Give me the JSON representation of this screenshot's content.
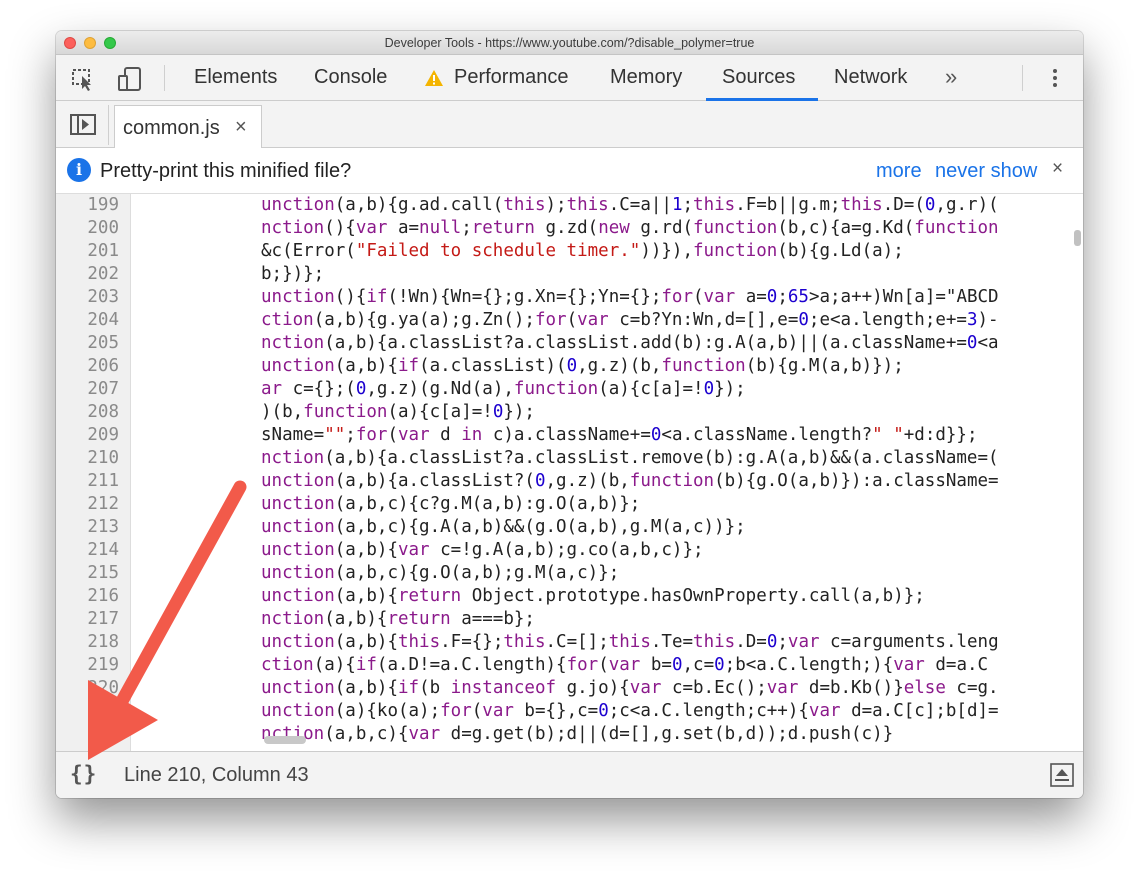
{
  "window": {
    "title": "Developer Tools - https://www.youtube.com/?disable_polymer=true"
  },
  "toolbar": {
    "inspect_icon": "inspect-element-icon",
    "device_icon": "device-toolbar-icon",
    "tabs": [
      {
        "label": "Elements"
      },
      {
        "label": "Console"
      },
      {
        "label": "Performance",
        "icon": "warning-icon"
      },
      {
        "label": "Memory"
      },
      {
        "label": "Sources",
        "active": true
      },
      {
        "label": "Network"
      }
    ],
    "more_tabs": "»",
    "menu_icon": "kebab-menu-icon"
  },
  "file_tabs": {
    "toggle_icon": "navigator-toggle-icon",
    "open_file": "common.js",
    "close_glyph": "×"
  },
  "infobar": {
    "message": "Pretty-print this minified file?",
    "more_link": "more",
    "never_show_link": "never show",
    "close_glyph": "×"
  },
  "editor": {
    "line_numbers": [
      "199",
      "200",
      "201",
      "202",
      "203",
      "204",
      "205",
      "206",
      "207",
      "208",
      "209",
      "210",
      "211",
      "212",
      "213",
      "214",
      "215",
      "216",
      "217",
      "218",
      "219",
      "220",
      "221",
      "222"
    ],
    "lines": [
      "unction(a,b){g.ad.call(this);this.C=a||1;this.F=b||g.m;this.D=(0,g.r)(",
      "nction(){var a=null;return g.zd(new g.rd(function(b,c){a=g.Kd(function",
      "&c(Error(\"Failed to schedule timer.\"))}),function(b){g.Ld(a);",
      "b;})};",
      "unction(){if(!Wn){Wn={};g.Xn={};Yn={};for(var a=0;65>a;a++)Wn[a]=\"ABCD",
      "ction(a,b){g.ya(a);g.Zn();for(var c=b?Yn:Wn,d=[],e=0;e<a.length;e+=3)-",
      "nction(a,b){a.classList?a.classList.add(b):g.A(a,b)||(a.className+=0<a",
      "unction(a,b){if(a.classList)(0,g.z)(b,function(b){g.M(a,b)});",
      "ar c={};(0,g.z)(g.Nd(a),function(a){c[a]=!0});",
      ")(b,function(a){c[a]=!0});",
      "sName=\"\";for(var d in c)a.className+=0<a.className.length?\" \"+d:d}};",
      "nction(a,b){a.classList?a.classList.remove(b):g.A(a,b)&&(a.className=(",
      "unction(a,b){a.classList?(0,g.z)(b,function(b){g.O(a,b)}):a.className=",
      "unction(a,b,c){c?g.M(a,b):g.O(a,b)};",
      "unction(a,b,c){g.A(a,b)&&(g.O(a,b),g.M(a,c))};",
      "unction(a,b){var c=!g.A(a,b);g.co(a,b,c)};",
      "unction(a,b,c){g.O(a,b);g.M(a,c)};",
      "unction(a,b){return Object.prototype.hasOwnProperty.call(a,b)};",
      "nction(a,b){return a===b};",
      "unction(a,b){this.F={};this.C=[];this.Te=this.D=0;var c=arguments.leng",
      "ction(a){if(a.D!=a.C.length){for(var b=0,c=0;b<a.C.length;){var d=a.C",
      "unction(a,b){if(b instanceof g.jo){var c=b.Ec();var d=b.Kb()}else c=g.",
      "unction(a){ko(a);for(var b={},c=0;c<a.C.length;c++){var d=a.C[c];b[d]=",
      "nction(a,b,c){var d=g.get(b);d||(d=[],g.set(b,d));d.push(c)}"
    ]
  },
  "statusbar": {
    "pretty_print_icon": "{}",
    "cursor_position": "Line 210, Column 43",
    "drawer_icon": "show-drawer-icon"
  },
  "colors": {
    "accent": "#1a73e8",
    "keyword": "#8b1a8b",
    "string": "#c41a16",
    "number": "#1c00cf",
    "annotation_arrow": "#f25a4a"
  }
}
